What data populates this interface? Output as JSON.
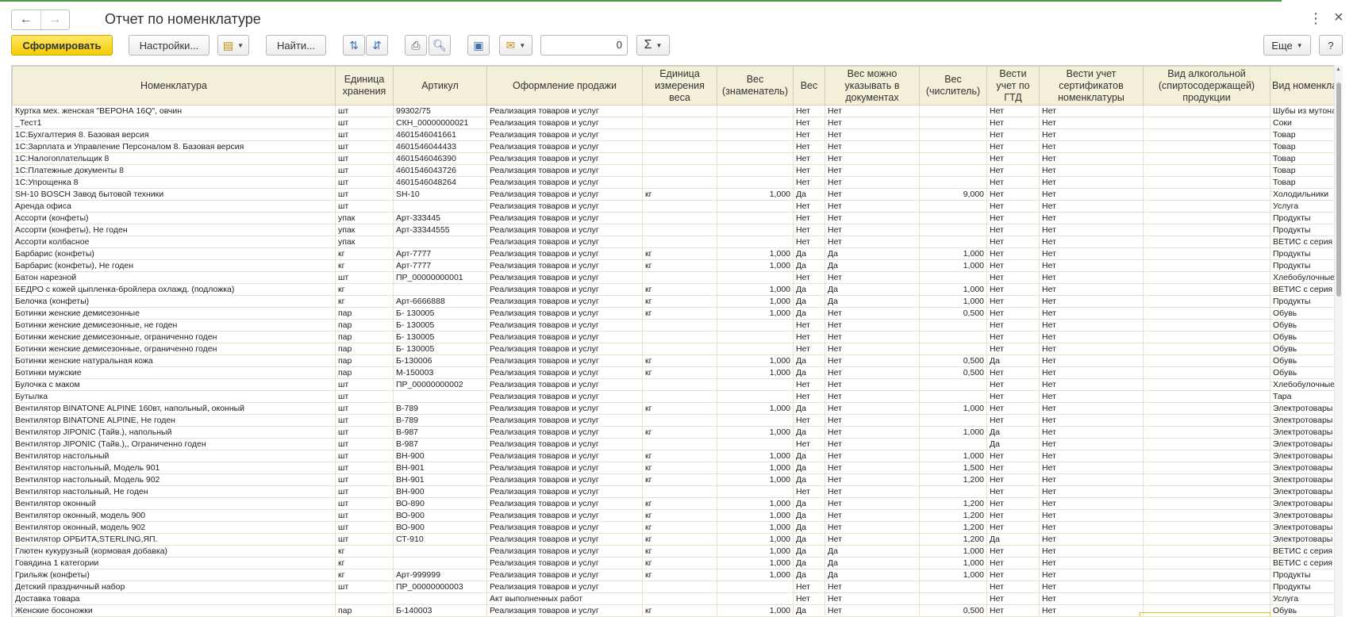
{
  "window": {
    "title": "Отчет по номенклатуре",
    "back_icon": "←",
    "forward_icon": "→",
    "more_icon": "⋮",
    "close_icon": "×"
  },
  "toolbar": {
    "generate_label": "Сформировать",
    "settings_label": "Настройки...",
    "find_label": "Найти...",
    "number_value": "0",
    "more_label": "Еще",
    "help_label": "?",
    "sigma_label": "Σ"
  },
  "table": {
    "headers": [
      "Номенклатура",
      "Единица хранения",
      "Артикул",
      "Оформление продажи",
      "Единица измерения веса",
      "Вес (знаменатель)",
      "Вес",
      "Вес можно указывать в документах",
      "Вес (числитель)",
      "Вести учет по ГТД",
      "Вести учет сертификатов номенклатуры",
      "Вид алкогольной (спиртосодержащей) продукции",
      "Вид номенклатуры"
    ],
    "rows": [
      [
        " Куртка мех. женская \"ВЕРОНА 16Q\", овчин",
        "шт",
        "99302/75",
        "Реализация товаров и услуг",
        "",
        "",
        "Нет",
        "Нет",
        "",
        "Нет",
        "Нет",
        "",
        "Шубы из мутона"
      ],
      [
        "_Тест1",
        "шт",
        "СКН_00000000021",
        "Реализация товаров и услуг",
        "",
        "",
        "Нет",
        "Нет",
        "",
        "Нет",
        "Нет",
        "",
        "Соки"
      ],
      [
        "1С:Бухгалтерия 8. Базовая версия",
        "шт",
        "4601546041661",
        "Реализация товаров и услуг",
        "",
        "",
        "Нет",
        "Нет",
        "",
        "Нет",
        "Нет",
        "",
        "Товар"
      ],
      [
        "1С:Зарплата и Управление Персоналом 8. Базовая версия",
        "шт",
        "4601546044433",
        "Реализация товаров и услуг",
        "",
        "",
        "Нет",
        "Нет",
        "",
        "Нет",
        "Нет",
        "",
        "Товар"
      ],
      [
        "1С:Налогоплательщик 8",
        "шт",
        "4601546046390",
        "Реализация товаров и услуг",
        "",
        "",
        "Нет",
        "Нет",
        "",
        "Нет",
        "Нет",
        "",
        "Товар"
      ],
      [
        "1С:Платежные документы 8",
        "шт",
        "4601546043726",
        "Реализация товаров и услуг",
        "",
        "",
        "Нет",
        "Нет",
        "",
        "Нет",
        "Нет",
        "",
        "Товар"
      ],
      [
        "1С:Упрощенка 8",
        "шт",
        "4601546048264",
        "Реализация товаров и услуг",
        "",
        "",
        "Нет",
        "Нет",
        "",
        "Нет",
        "Нет",
        "",
        "Товар"
      ],
      [
        "SH-10 BOSCH Завод бытовой техники",
        "шт",
        "SH-10",
        "Реализация товаров и услуг",
        "кг",
        "1,000",
        "Да",
        "Нет",
        "9,000",
        "Нет",
        "Нет",
        "",
        "Холодильники"
      ],
      [
        "Аренда офиса",
        "шт",
        "",
        "Реализация товаров и услуг",
        "",
        "",
        "Нет",
        "Нет",
        "",
        "Нет",
        "Нет",
        "",
        "Услуга"
      ],
      [
        "Ассорти (конфеты)",
        "упак",
        "Арт-333445",
        "Реализация товаров и услуг",
        "",
        "",
        "Нет",
        "Нет",
        "",
        "Нет",
        "Нет",
        "",
        "Продукты"
      ],
      [
        "Ассорти (конфеты), Не годен",
        "упак",
        "Арт-33344555",
        "Реализация товаров и услуг",
        "",
        "",
        "Нет",
        "Нет",
        "",
        "Нет",
        "Нет",
        "",
        "Продукты"
      ],
      [
        "Ассорти колбасное",
        "упак",
        "",
        "Реализация товаров и услуг",
        "",
        "",
        "Нет",
        "Нет",
        "",
        "Нет",
        "Нет",
        "",
        "ВЕТИС с серия"
      ],
      [
        "Барбарис (конфеты)",
        "кг",
        "Арт-7777",
        "Реализация товаров и услуг",
        "кг",
        "1,000",
        "Да",
        "Да",
        "1,000",
        "Нет",
        "Нет",
        "",
        "Продукты"
      ],
      [
        "Барбарис (конфеты), Не годен",
        "кг",
        "Арт-7777",
        "Реализация товаров и услуг",
        "кг",
        "1,000",
        "Да",
        "Да",
        "1,000",
        "Нет",
        "Нет",
        "",
        "Продукты"
      ],
      [
        "Батон нарезной",
        "шт",
        "ПР_00000000001",
        "Реализация товаров и услуг",
        "",
        "",
        "Нет",
        "Нет",
        "",
        "Нет",
        "Нет",
        "",
        "Хлебобулочные"
      ],
      [
        "БЕДРО с кожей цыпленка-бройлера охлажд. (подложка)",
        "кг",
        "",
        "Реализация товаров и услуг",
        "кг",
        "1,000",
        "Да",
        "Да",
        "1,000",
        "Нет",
        "Нет",
        "",
        "ВЕТИС с серия"
      ],
      [
        "Белочка (конфеты)",
        "кг",
        "Арт-6666888",
        "Реализация товаров и услуг",
        "кг",
        "1,000",
        "Да",
        "Да",
        "1,000",
        "Нет",
        "Нет",
        "",
        "Продукты"
      ],
      [
        "Ботинки женские демисезонные",
        "пар",
        "Б- 130005",
        "Реализация товаров и услуг",
        "кг",
        "1,000",
        "Да",
        "Нет",
        "0,500",
        "Нет",
        "Нет",
        "",
        "Обувь"
      ],
      [
        "Ботинки женские демисезонные, не годен",
        "пар",
        "Б- 130005",
        "Реализация товаров и услуг",
        "",
        "",
        "Нет",
        "Нет",
        "",
        "Нет",
        "Нет",
        "",
        "Обувь"
      ],
      [
        "Ботинки женские демисезонные, ограниченно годен",
        "пар",
        "Б- 130005",
        "Реализация товаров и услуг",
        "",
        "",
        "Нет",
        "Нет",
        "",
        "Нет",
        "Нет",
        "",
        "Обувь"
      ],
      [
        "Ботинки женские демисезонные, ограниченно годен",
        "пар",
        "Б- 130005",
        "Реализация товаров и услуг",
        "",
        "",
        "Нет",
        "Нет",
        "",
        "Нет",
        "Нет",
        "",
        "Обувь"
      ],
      [
        "Ботинки женские натуральная кожа",
        "пар",
        "Б-130006",
        "Реализация товаров и услуг",
        "кг",
        "1,000",
        "Да",
        "Нет",
        "0,500",
        "Да",
        "Нет",
        "",
        "Обувь"
      ],
      [
        "Ботинки мужские",
        "пар",
        "М-150003",
        "Реализация товаров и услуг",
        "кг",
        "1,000",
        "Да",
        "Нет",
        "0,500",
        "Нет",
        "Нет",
        "",
        "Обувь"
      ],
      [
        "Булочка с маком",
        "шт",
        "ПР_00000000002",
        "Реализация товаров и услуг",
        "",
        "",
        "Нет",
        "Нет",
        "",
        "Нет",
        "Нет",
        "",
        "Хлебобулочные"
      ],
      [
        "Бутылка",
        "шт",
        "",
        "Реализация товаров и услуг",
        "",
        "",
        "Нет",
        "Нет",
        "",
        "Нет",
        "Нет",
        "",
        "Тара"
      ],
      [
        "Вентилятор BINATONE ALPINE 160вт, напольный, оконный",
        "шт",
        "В-789",
        "Реализация товаров и услуг",
        "кг",
        "1,000",
        "Да",
        "Нет",
        "1,000",
        "Нет",
        "Нет",
        "",
        "Электротовары"
      ],
      [
        "Вентилятор BINATONE ALPINE, Не годен",
        "шт",
        "В-789",
        "Реализация товаров и услуг",
        "",
        "",
        "Нет",
        "Нет",
        "",
        "Нет",
        "Нет",
        "",
        "Электротовары"
      ],
      [
        "Вентилятор JIPONIC (Тайв.), напольный",
        "шт",
        "В-987",
        "Реализация товаров и услуг",
        "кг",
        "1,000",
        "Да",
        "Нет",
        "1,000",
        "Да",
        "Нет",
        "",
        "Электротовары"
      ],
      [
        "Вентилятор JIPONIC (Тайв.),, Ограниченно годен",
        "шт",
        "В-987",
        "Реализация товаров и услуг",
        "",
        "",
        "Нет",
        "Нет",
        "",
        "Да",
        "Нет",
        "",
        "Электротовары"
      ],
      [
        "Вентилятор настольный",
        "шт",
        "ВН-900",
        "Реализация товаров и услуг",
        "кг",
        "1,000",
        "Да",
        "Нет",
        "1,000",
        "Нет",
        "Нет",
        "",
        "Электротовары"
      ],
      [
        "Вентилятор настольный, Модель 901",
        "шт",
        "ВН-901",
        "Реализация товаров и услуг",
        "кг",
        "1,000",
        "Да",
        "Нет",
        "1,500",
        "Нет",
        "Нет",
        "",
        "Электротовары"
      ],
      [
        "Вентилятор настольный, Модель 902",
        "шт",
        "ВН-901",
        "Реализация товаров и услуг",
        "кг",
        "1,000",
        "Да",
        "Нет",
        "1,200",
        "Нет",
        "Нет",
        "",
        "Электротовары"
      ],
      [
        "Вентилятор настольный, Не годен",
        "шт",
        "ВН-900",
        "Реализация товаров и услуг",
        "",
        "",
        "Нет",
        "Нет",
        "",
        "Нет",
        "Нет",
        "",
        "Электротовары"
      ],
      [
        "Вентилятор оконный",
        "шт",
        "ВО-890",
        "Реализация товаров и услуг",
        "кг",
        "1,000",
        "Да",
        "Нет",
        "1,200",
        "Нет",
        "Нет",
        "",
        "Электротовары"
      ],
      [
        "Вентилятор оконный, модель 900",
        "шт",
        "ВО-900",
        "Реализация товаров и услуг",
        "кг",
        "1,000",
        "Да",
        "Нет",
        "1,200",
        "Нет",
        "Нет",
        "",
        "Электротовары"
      ],
      [
        "Вентилятор оконный, модель 902",
        "шт",
        "ВО-900",
        "Реализация товаров и услуг",
        "кг",
        "1,000",
        "Да",
        "Нет",
        "1,200",
        "Нет",
        "Нет",
        "",
        "Электротовары"
      ],
      [
        "Вентилятор ОРБИТА,STERLING,ЯП.",
        "шт",
        "СТ-910",
        "Реализация товаров и услуг",
        "кг",
        "1,000",
        "Да",
        "Нет",
        "1,200",
        "Да",
        "Нет",
        "",
        "Электротовары"
      ],
      [
        "Глютен кукурузный (кормовая добавка)",
        "кг",
        "",
        "Реализация товаров и услуг",
        "кг",
        "1,000",
        "Да",
        "Да",
        "1,000",
        "Нет",
        "Нет",
        "",
        "ВЕТИС с серия"
      ],
      [
        "Говядина 1 категории",
        "кг",
        "",
        "Реализация товаров и услуг",
        "кг",
        "1,000",
        "Да",
        "Да",
        "1,000",
        "Нет",
        "Нет",
        "",
        "ВЕТИС с серия"
      ],
      [
        "Грильяж (конфеты)",
        "кг",
        "Арт-999999",
        "Реализация товаров и услуг",
        "кг",
        "1,000",
        "Да",
        "Да",
        "1,000",
        "Нет",
        "Нет",
        "",
        "Продукты"
      ],
      [
        "Детский праздничный набор",
        "шт",
        "ПР_00000000003",
        "Реализация товаров и услуг",
        "",
        "",
        "Нет",
        "Нет",
        "",
        "Нет",
        "Нет",
        "",
        "Продукты"
      ],
      [
        "Доставка товара",
        "",
        "",
        "Акт выполненных работ",
        "",
        "",
        "Нет",
        "Нет",
        "",
        "Нет",
        "Нет",
        "",
        "Услуга"
      ],
      [
        "Женские босоножки",
        "пар",
        "Б-140003",
        "Реализация товаров и услуг",
        "кг",
        "1,000",
        "Да",
        "Нет",
        "0,500",
        "Нет",
        "Нет",
        "",
        "Обувь"
      ]
    ]
  }
}
